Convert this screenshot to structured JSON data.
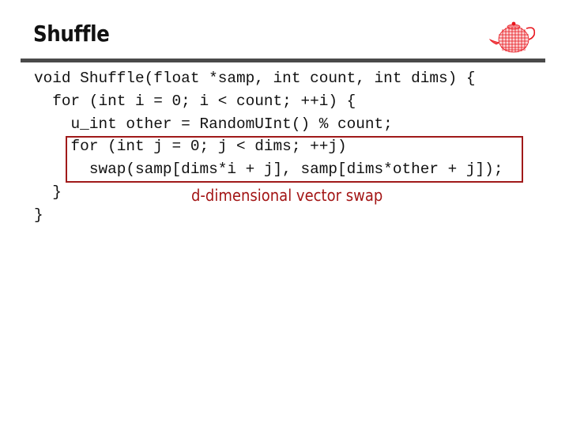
{
  "slide": {
    "title": "Shuffle",
    "logo_icon": "teapot-wireframe-icon",
    "accent_color": "#a01a1a",
    "divider_color": "#4a4a4a"
  },
  "code": {
    "language": "C++",
    "lines": [
      "void Shuffle(float *samp, int count, int dims) {",
      "  for (int i = 0; i < count; ++i) {",
      "    u_int other = RandomUInt() % count;",
      "    for (int j = 0; j < dims; ++j)",
      "      swap(samp[dims*i + j], samp[dims*other + j]);",
      "  }",
      "}"
    ],
    "highlighted_lines": [
      4,
      5
    ]
  },
  "annotation": {
    "text": "d-dimensional vector swap",
    "color": "#a31515"
  }
}
